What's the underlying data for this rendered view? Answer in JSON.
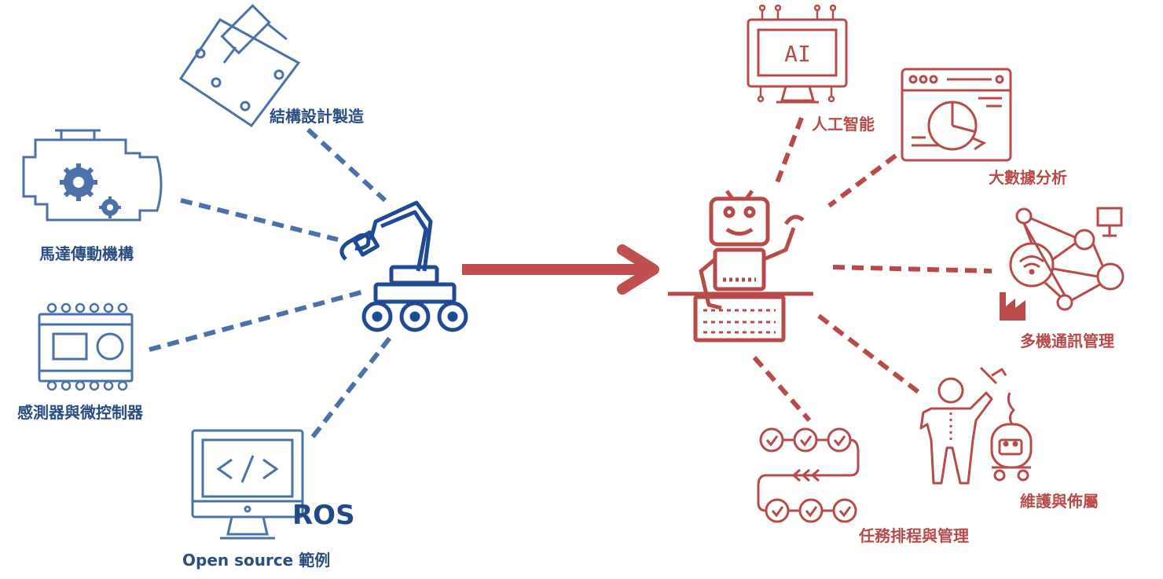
{
  "left_nodes": {
    "structure": "結構設計製造",
    "motor": "馬達傳動機構",
    "sensor": "感測器與微控制器",
    "ros": "ROS",
    "opensource": "Open source 範例"
  },
  "right_nodes": {
    "ai": "人工智能",
    "bigdata": "大數據分析",
    "multi": "多機通訊管理",
    "maint": "維護與佈屬",
    "task": "任務排程與管理"
  },
  "icons": {
    "structure": "cnc-plate-icon",
    "motor": "engine-gears-icon",
    "sensor": "sensor-module-icon",
    "ros": "code-monitor-icon",
    "center_left": "robot-arm-rover-icon",
    "center_right": "robot-keyboard-icon",
    "ai": "ai-chip-monitor-icon",
    "bigdata": "analytics-window-icon",
    "multi": "network-wifi-icon",
    "maint": "engineer-robot-icon",
    "task": "workflow-icon",
    "arrow": "arrow-right-icon"
  },
  "icon_text": {
    "ai": "AI"
  },
  "colors": {
    "blue": "#4a72a8",
    "dark_blue": "#1f4a96",
    "red": "#b84a4a"
  }
}
